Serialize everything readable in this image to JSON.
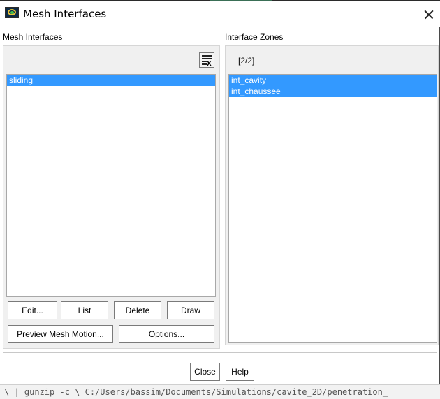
{
  "window": {
    "title": "Mesh Interfaces"
  },
  "mesh_interfaces": {
    "label": "Mesh Interfaces",
    "items": [
      {
        "label": "sliding",
        "selected": true
      }
    ],
    "buttons": {
      "edit": "Edit...",
      "list": "List",
      "delete": "Delete",
      "draw": "Draw",
      "preview": "Preview Mesh Motion...",
      "options": "Options..."
    }
  },
  "interface_zones": {
    "label": "Interface Zones",
    "count": "[2/2]",
    "items": [
      {
        "label": "int_cavity",
        "selected": true
      },
      {
        "label": "int_chaussee",
        "selected": true
      }
    ]
  },
  "footer": {
    "close": "Close",
    "help": "Help"
  },
  "console_text": "\\ | gunzip -c \\ C:/Users/bassim/Documents/Simulations/cavite_2D/penetration_",
  "colors": {
    "selection": "#3399ff",
    "panel": "#f0f0f0"
  },
  "icons": [
    "app-icon",
    "close-icon",
    "clear-selection-icon"
  ]
}
